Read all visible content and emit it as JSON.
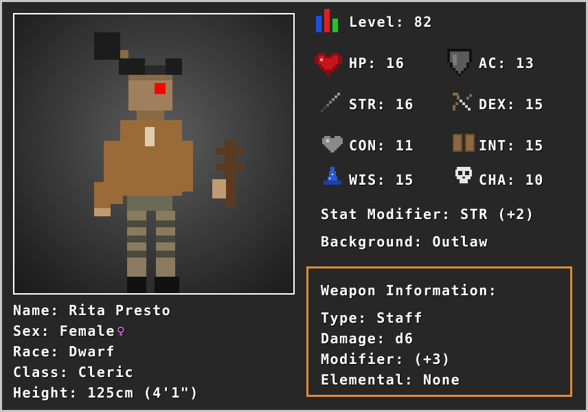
{
  "character": {
    "name_label": "Name:",
    "name": "Rita Presto",
    "sex_label": "Sex:",
    "sex": "Female",
    "sex_symbol": "♀",
    "race_label": "Race:",
    "race": "Dwarf",
    "class_label": "Class:",
    "class": "Cleric",
    "height_label": "Height:",
    "height": "125cm (4'1\")"
  },
  "stats": {
    "level_label": "Level:",
    "level": "82",
    "hp_label": "HP:",
    "hp": "16",
    "ac_label": "AC:",
    "ac": "13",
    "str_label": "STR:",
    "str": "16",
    "dex_label": "DEX:",
    "dex": "15",
    "con_label": "CON:",
    "con": "11",
    "int_label": "INT:",
    "int": "15",
    "wis_label": "WIS:",
    "wis": "15",
    "cha_label": "CHA:",
    "cha": "10",
    "modifier_label": "Stat Modifier:",
    "modifier": "STR (+2)",
    "background_label": "Background:",
    "background": "Outlaw"
  },
  "weapon": {
    "title": "Weapon Information:",
    "type_label": "Type:",
    "type": "Staff",
    "damage_label": "Damage:",
    "damage": "d6",
    "modifier_label": "Modifier:",
    "modifier": "(+3)",
    "elemental_label": "Elemental:",
    "elemental": "None"
  },
  "colors": {
    "panel_bg": "#272727",
    "frame": "#c8c8c8",
    "weapon_border": "#e08a3c",
    "female_symbol": "#e57de0",
    "eye": "#ff0000"
  },
  "icons": [
    "level-bars-icon",
    "heart-icon",
    "shield-icon",
    "sword-icon",
    "bow-icon",
    "grey-heart-icon",
    "book-icon",
    "wizard-hat-icon",
    "skull-icon"
  ]
}
